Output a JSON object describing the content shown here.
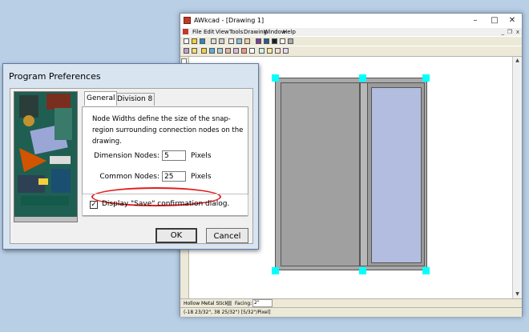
{
  "app": {
    "title": "AWkcad - [Drawing 1]",
    "controls": {
      "minimize": "–",
      "maximize": "□",
      "close": "✕"
    },
    "mdi_controls": {
      "minimize": "_",
      "restore": "❐",
      "close": "x"
    },
    "menu": [
      "File",
      "Edit",
      "View",
      "Tools",
      "Drawing",
      "Window",
      "Help"
    ],
    "status": {
      "stick_label": "Hollow Metal Stick:",
      "facing_label": "Facing:",
      "facing_value": "2\"",
      "coords": "(-18 23/32\", 38 25/32\") [5/32\"/Pixel]"
    }
  },
  "dialog": {
    "title": "Program Preferences",
    "tabs": [
      "General",
      "Division 8"
    ],
    "active_tab": "General",
    "description": "Node Widths define the size of the snap-region surrounding connection nodes on the drawing.",
    "dimension_nodes_label": "Dimension Nodes:",
    "dimension_nodes_value": "5",
    "common_nodes_label": "Common Nodes:",
    "common_nodes_value": "25",
    "units": "Pixels",
    "display_save_label": "Display \"Save\" confirmation dialog.",
    "display_save_checked": true,
    "check_glyph": "✓",
    "ok_label": "OK",
    "cancel_label": "Cancel"
  },
  "colors": {
    "node": "#00ffff",
    "frame_grey": "#a0a0a0",
    "panel_blue": "#b3bde0",
    "highlight_oval": "#e11d1d",
    "desktop": "#b9cfe6"
  }
}
